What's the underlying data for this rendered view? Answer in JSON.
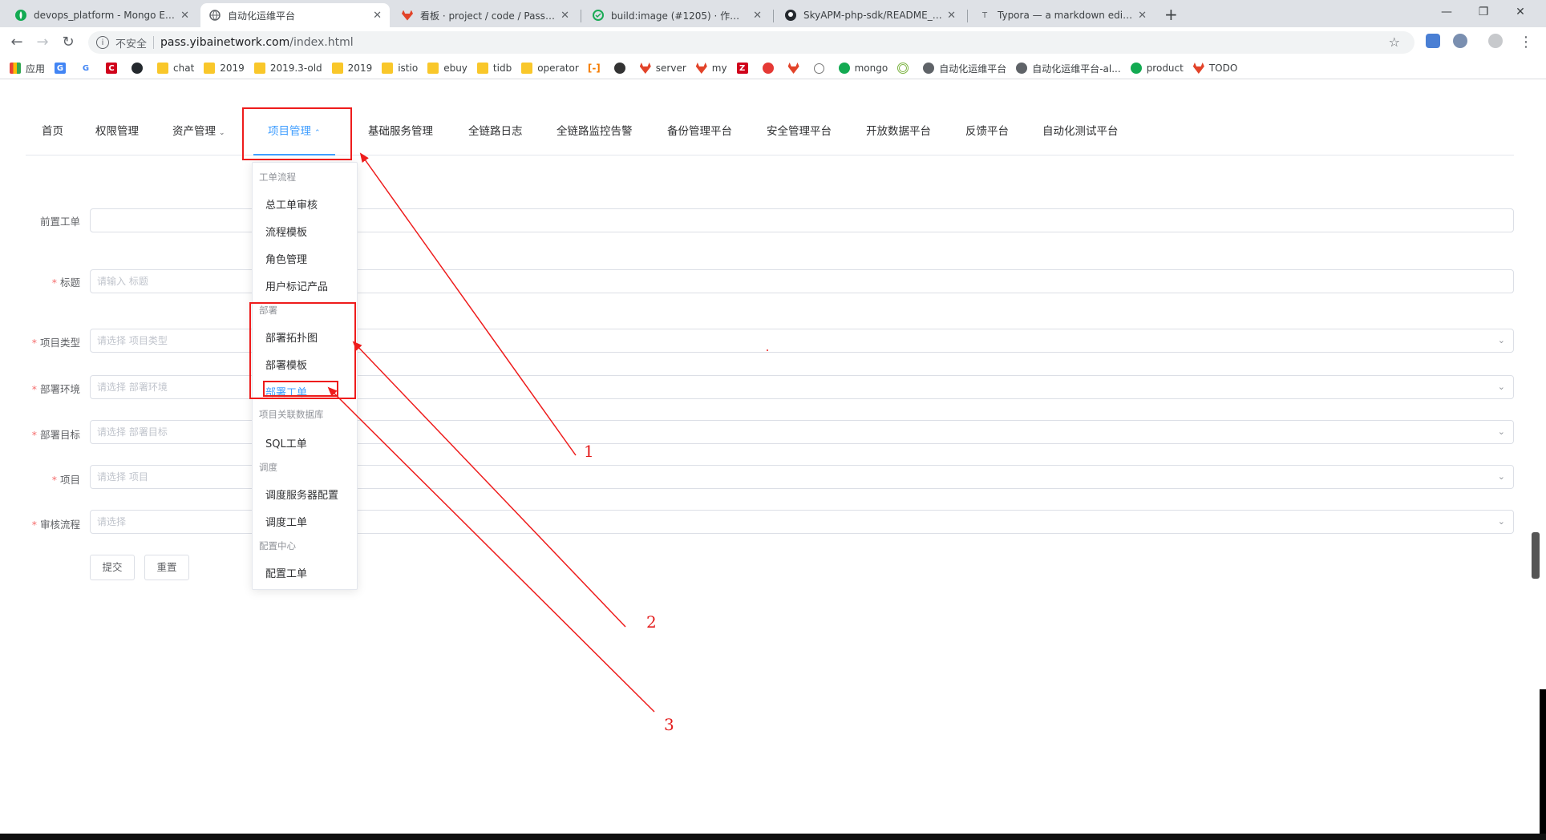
{
  "browser": {
    "tabs": [
      {
        "title": "devops_platform - Mongo Exp",
        "icon": "mongo-leaf-icon"
      },
      {
        "title": "自动化运维平台",
        "icon": "globe-icon"
      },
      {
        "title": "看板 · project / code / Pass / d",
        "icon": "gitlab-fox-icon"
      },
      {
        "title": "build:image (#1205) · 作业 · pr",
        "icon": "gitlab-pipeline-icon"
      },
      {
        "title": "SkyAPM-php-sdk/README_Zh",
        "icon": "github-icon"
      },
      {
        "title": "Typora — a markdown editor,",
        "icon": "typora-icon"
      }
    ],
    "new_tab": "+",
    "window_controls": {
      "minimize": "—",
      "restore": "❐",
      "close": "✕"
    },
    "address": {
      "security_label": "不安全",
      "host": "pass.yibainetwork.com",
      "path": "/index.html"
    },
    "bookmarks": [
      {
        "label": "应用",
        "icon": "apps-grid-icon"
      },
      {
        "label": "",
        "icon": "translate-icon"
      },
      {
        "label": "",
        "icon": "google-icon"
      },
      {
        "label": "",
        "icon": "c-red-icon"
      },
      {
        "label": "",
        "icon": "github-icon"
      },
      {
        "label": "chat",
        "icon": "folder-icon"
      },
      {
        "label": "2019",
        "icon": "folder-icon"
      },
      {
        "label": "2019.3-old",
        "icon": "folder-icon"
      },
      {
        "label": "2019",
        "icon": "folder-icon"
      },
      {
        "label": "istio",
        "icon": "folder-icon"
      },
      {
        "label": "ebuy",
        "icon": "folder-icon"
      },
      {
        "label": "tidb",
        "icon": "folder-icon"
      },
      {
        "label": "operator",
        "icon": "folder-icon"
      },
      {
        "label": "",
        "icon": "bracket-orange-icon"
      },
      {
        "label": "",
        "icon": "circle-dark-icon"
      },
      {
        "label": "server",
        "icon": "gitlab-fox-icon"
      },
      {
        "label": "my",
        "icon": "gitlab-fox-icon"
      },
      {
        "label": "",
        "icon": "z-red-icon"
      },
      {
        "label": "",
        "icon": "red-round-icon"
      },
      {
        "label": "",
        "icon": "gitlab-fox-icon"
      },
      {
        "label": "",
        "icon": "grey-round-icon"
      },
      {
        "label": "mongo",
        "icon": "mongo-leaf-icon"
      },
      {
        "label": "",
        "icon": "green-ring-icon"
      },
      {
        "label": "自动化运维平台",
        "icon": "globe-icon"
      },
      {
        "label": "自动化运维平台-al...",
        "icon": "globe-icon"
      },
      {
        "label": "product",
        "icon": "mongo-leaf-icon"
      },
      {
        "label": "TODO",
        "icon": "gitlab-fox-icon"
      }
    ]
  },
  "nav": {
    "items": [
      {
        "label": "首页",
        "chevron": ""
      },
      {
        "label": "权限管理",
        "chevron": ""
      },
      {
        "label": "资产管理",
        "chevron": "⌄"
      },
      {
        "label": "项目管理",
        "chevron": "⌃"
      },
      {
        "label": "基础服务管理",
        "chevron": ""
      },
      {
        "label": "全链路日志",
        "chevron": ""
      },
      {
        "label": "全链路监控告警",
        "chevron": ""
      },
      {
        "label": "备份管理平台",
        "chevron": ""
      },
      {
        "label": "安全管理平台",
        "chevron": ""
      },
      {
        "label": "开放数据平台",
        "chevron": ""
      },
      {
        "label": "反馈平台",
        "chevron": ""
      },
      {
        "label": "自动化测试平台",
        "chevron": ""
      }
    ],
    "active_item": "项目管理"
  },
  "dropdown": {
    "groups": [
      {
        "title": "工单流程",
        "items": [
          "总工单审核",
          "流程模板",
          "角色管理",
          "用户标记产品"
        ]
      },
      {
        "title": "部署",
        "items": [
          "部署拓扑图",
          "部署模板",
          "部署工单"
        ]
      },
      {
        "title": "项目关联数据库",
        "items": [
          "SQL工单"
        ]
      },
      {
        "title": "调度",
        "items": [
          "调度服务器配置",
          "调度工单"
        ]
      },
      {
        "title": "配置中心",
        "items": [
          "配置工单"
        ]
      }
    ],
    "selected_item": "部署工单"
  },
  "form": {
    "fields": [
      {
        "label": "前置工单",
        "required": false,
        "placeholder": "",
        "type": "input"
      },
      {
        "label": "标题",
        "required": true,
        "placeholder": "请输入 标题",
        "type": "input"
      },
      {
        "label": "项目类型",
        "required": true,
        "placeholder": "请选择 项目类型",
        "type": "select"
      },
      {
        "label": "部署环境",
        "required": true,
        "placeholder": "请选择 部署环境",
        "type": "select"
      },
      {
        "label": "部署目标",
        "required": true,
        "placeholder": "请选择 部署目标",
        "type": "select"
      },
      {
        "label": "项目",
        "required": true,
        "placeholder": "请选择 项目",
        "type": "select"
      },
      {
        "label": "审核流程",
        "required": true,
        "placeholder": "请选择",
        "type": "select"
      }
    ],
    "required_mark": "*",
    "select_arrow": "⌄",
    "submit_label": "提交",
    "reset_label": "重置"
  },
  "annotations": {
    "numbers": [
      "1",
      "2",
      "3"
    ],
    "color": "#ee1c1c"
  },
  "colors": {
    "accent": "#409eff",
    "required": "#f56c6c",
    "annotation": "#ee1c1c"
  }
}
